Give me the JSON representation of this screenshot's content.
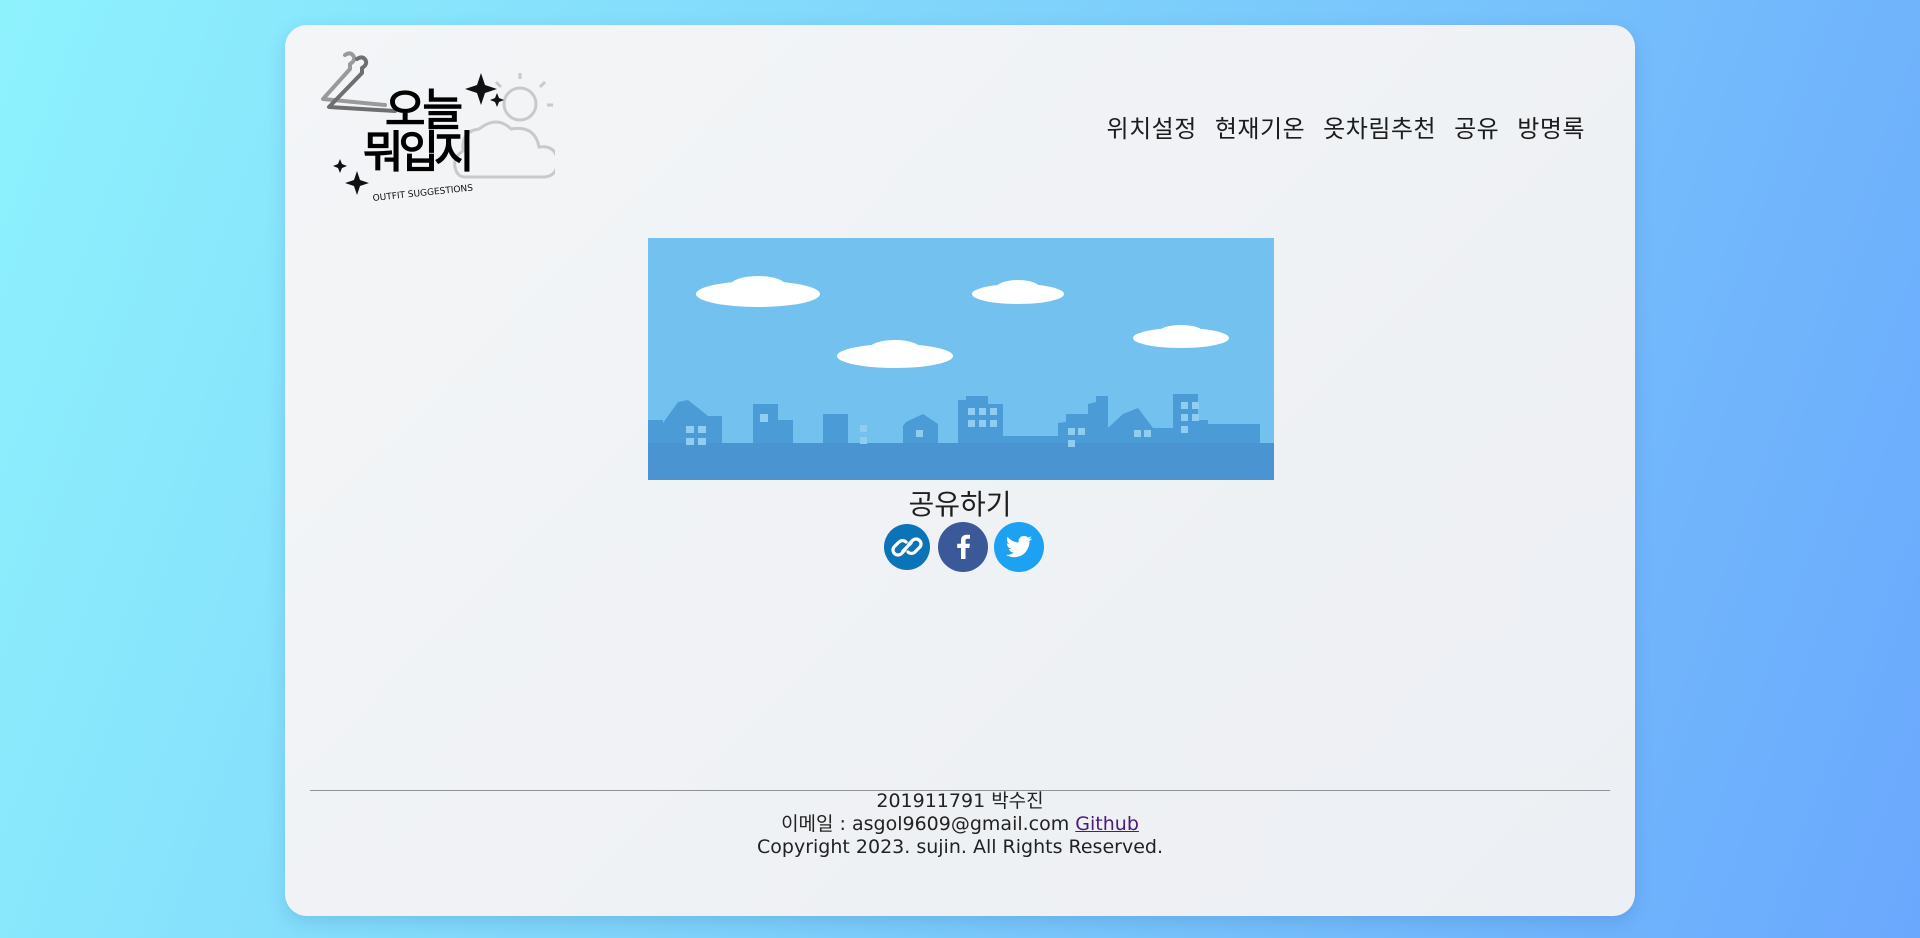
{
  "logo": {
    "wordmark_line1": "오늘",
    "wordmark_line2": "뭐입지",
    "tagline": "OUTFIT SUGGESTIONS"
  },
  "nav": {
    "items": [
      {
        "label": "위치설정"
      },
      {
        "label": "현재기온"
      },
      {
        "label": "옷차림추천"
      },
      {
        "label": "공유"
      },
      {
        "label": "방명록"
      }
    ]
  },
  "share": {
    "title": "공유하기",
    "buttons": [
      {
        "icon": "link-icon",
        "color": "#0b74b8"
      },
      {
        "icon": "facebook-icon",
        "color": "#3b5998"
      },
      {
        "icon": "twitter-icon",
        "color": "#1da1f2"
      }
    ]
  },
  "footer": {
    "student": "201911791 박수진",
    "email_prefix": "이메일 : asgol9609@gmail.com",
    "github_label": "Github",
    "copyright": "Copyright 2023. sujin. All Rights Reserved."
  },
  "colors": {
    "sky": "#72c1ee",
    "city": "#4a9bd6",
    "accent_link": "#4b1a7a"
  }
}
